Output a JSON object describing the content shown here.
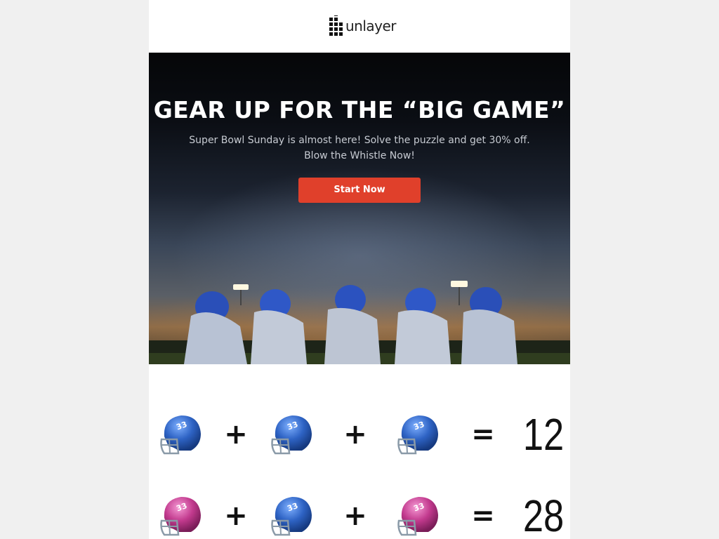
{
  "brand": {
    "name": "unlayer"
  },
  "hero": {
    "title": "GEAR UP FOR THE “BIG GAME”",
    "subtitle_line1": "Super Bowl Sunday is almost here! Solve the puzzle and get 30% off.",
    "subtitle_line2": "Blow the Whistle Now!",
    "cta_label": "Start Now",
    "cta_color": "#e0402b"
  },
  "puzzle": {
    "rows": [
      {
        "items": [
          "blue-helmet",
          "blue-helmet",
          "blue-helmet"
        ],
        "operators": [
          "+",
          "+",
          "="
        ],
        "result": "12"
      },
      {
        "items": [
          "pink-helmet",
          "blue-helmet",
          "pink-helmet"
        ],
        "operators": [
          "+",
          "+",
          "="
        ],
        "result": "28"
      }
    ],
    "helmet_number": "33",
    "colors": {
      "blue": "#2e63c4",
      "pink": "#c23a8e"
    }
  }
}
